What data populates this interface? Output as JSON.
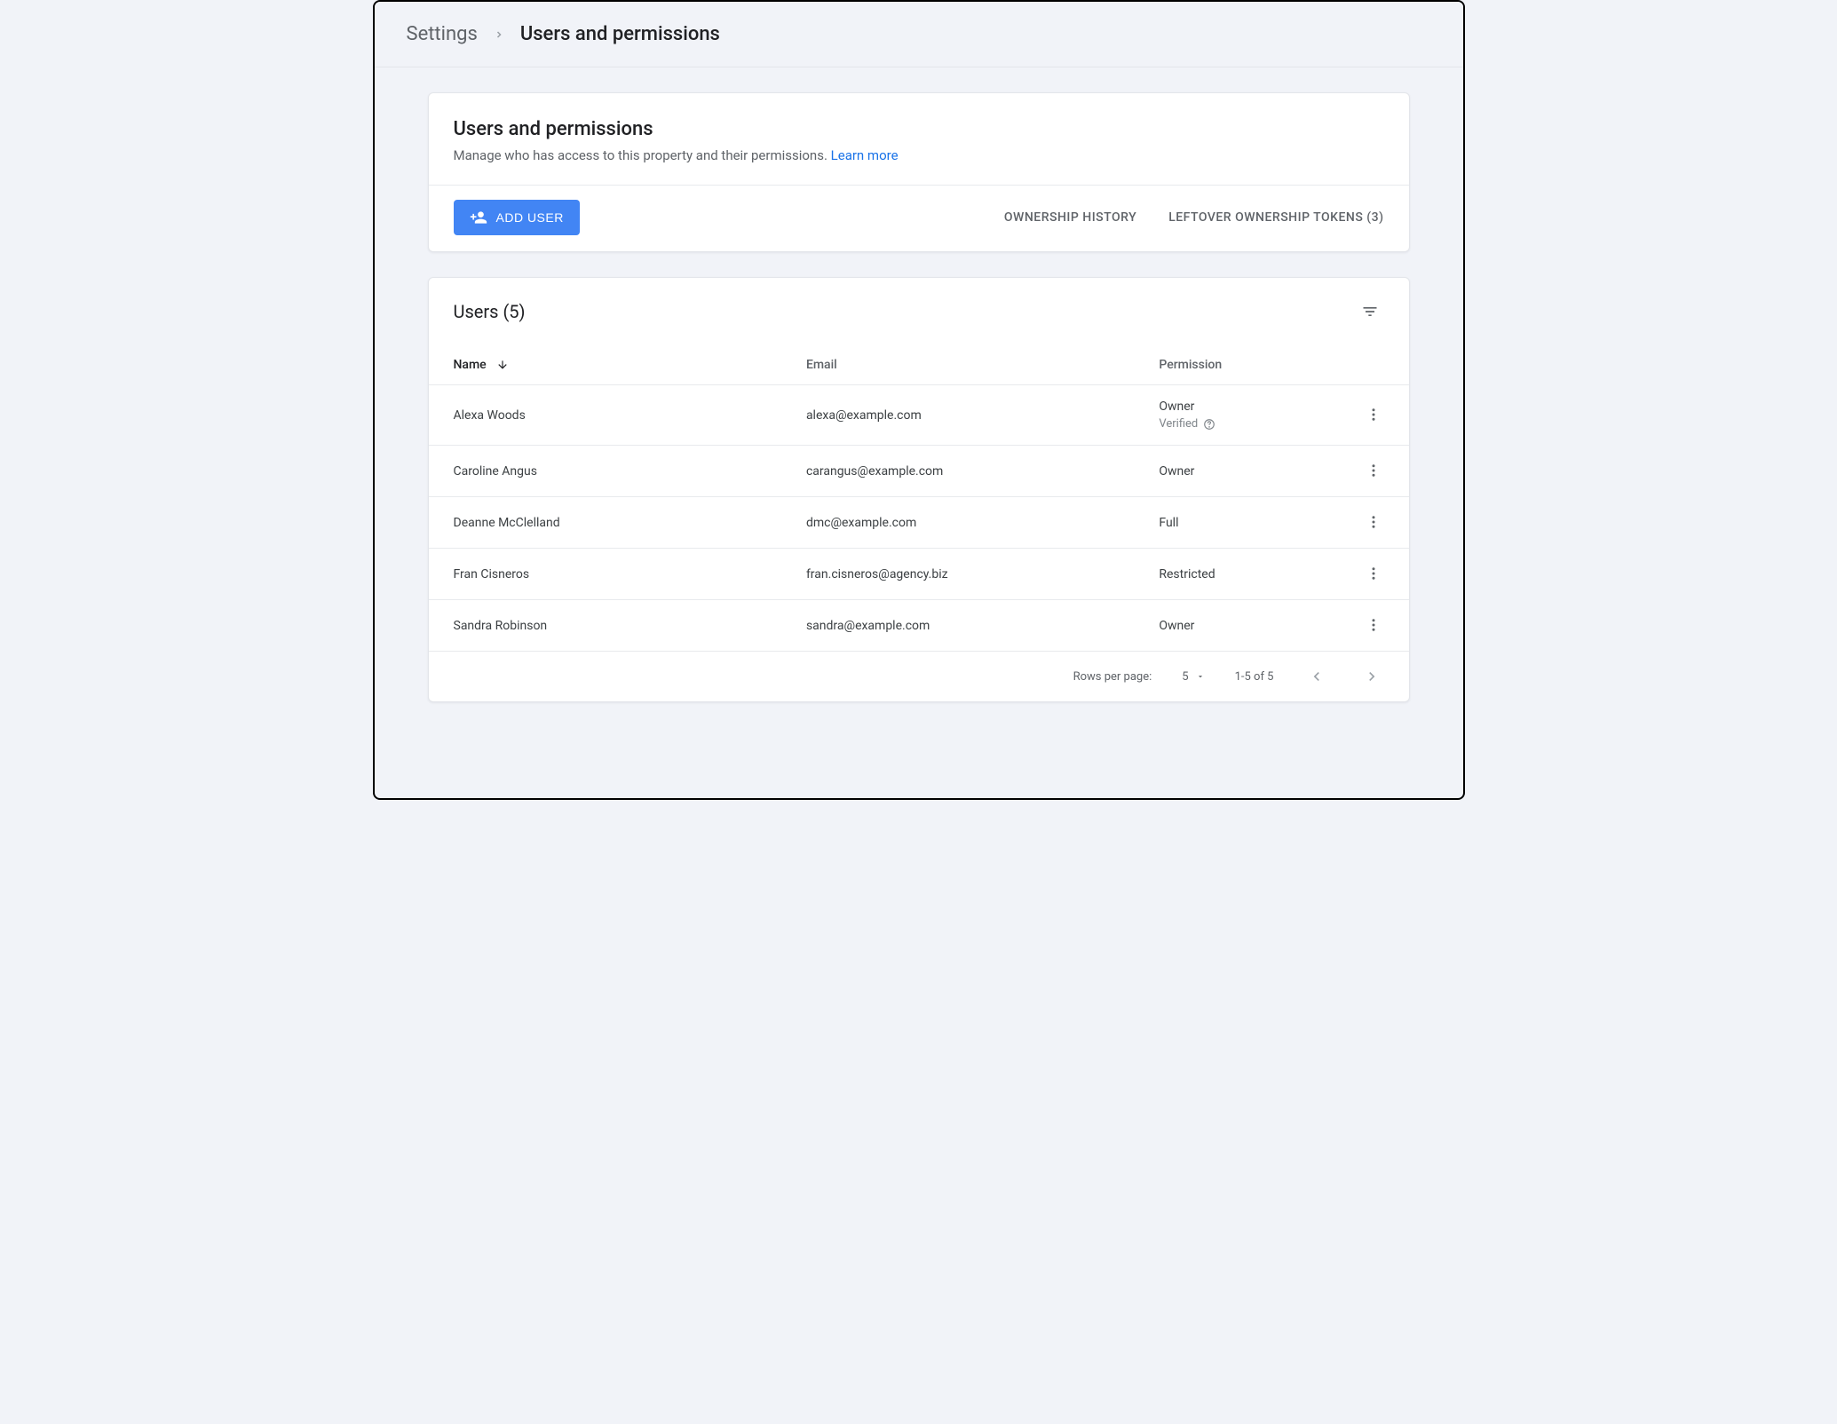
{
  "breadcrumb": {
    "root": "Settings",
    "current": "Users and permissions"
  },
  "header": {
    "title": "Users and permissions",
    "subtitle": "Manage who has access to this property and their permissions.",
    "learn_more": "Learn more"
  },
  "actions": {
    "add_user": "Add user",
    "ownership_history": "Ownership history",
    "leftover_tokens": "Leftover ownership tokens (3)"
  },
  "users": {
    "title": "Users (5)",
    "columns": {
      "name": "Name",
      "email": "Email",
      "permission": "Permission"
    },
    "verified_label": "Verified",
    "rows": [
      {
        "name": "Alexa Woods",
        "email": "alexa@example.com",
        "permission": "Owner",
        "verified": true
      },
      {
        "name": "Caroline Angus",
        "email": "carangus@example.com",
        "permission": "Owner",
        "verified": false
      },
      {
        "name": "Deanne McClelland",
        "email": "dmc@example.com",
        "permission": "Full",
        "verified": false
      },
      {
        "name": "Fran Cisneros",
        "email": "fran.cisneros@agency.biz",
        "permission": "Restricted",
        "verified": false
      },
      {
        "name": "Sandra Robinson",
        "email": "sandra@example.com",
        "permission": "Owner",
        "verified": false
      }
    ]
  },
  "pagination": {
    "rows_per_page_label": "Rows per page:",
    "rows_per_page_value": "5",
    "range": "1-5 of 5"
  }
}
